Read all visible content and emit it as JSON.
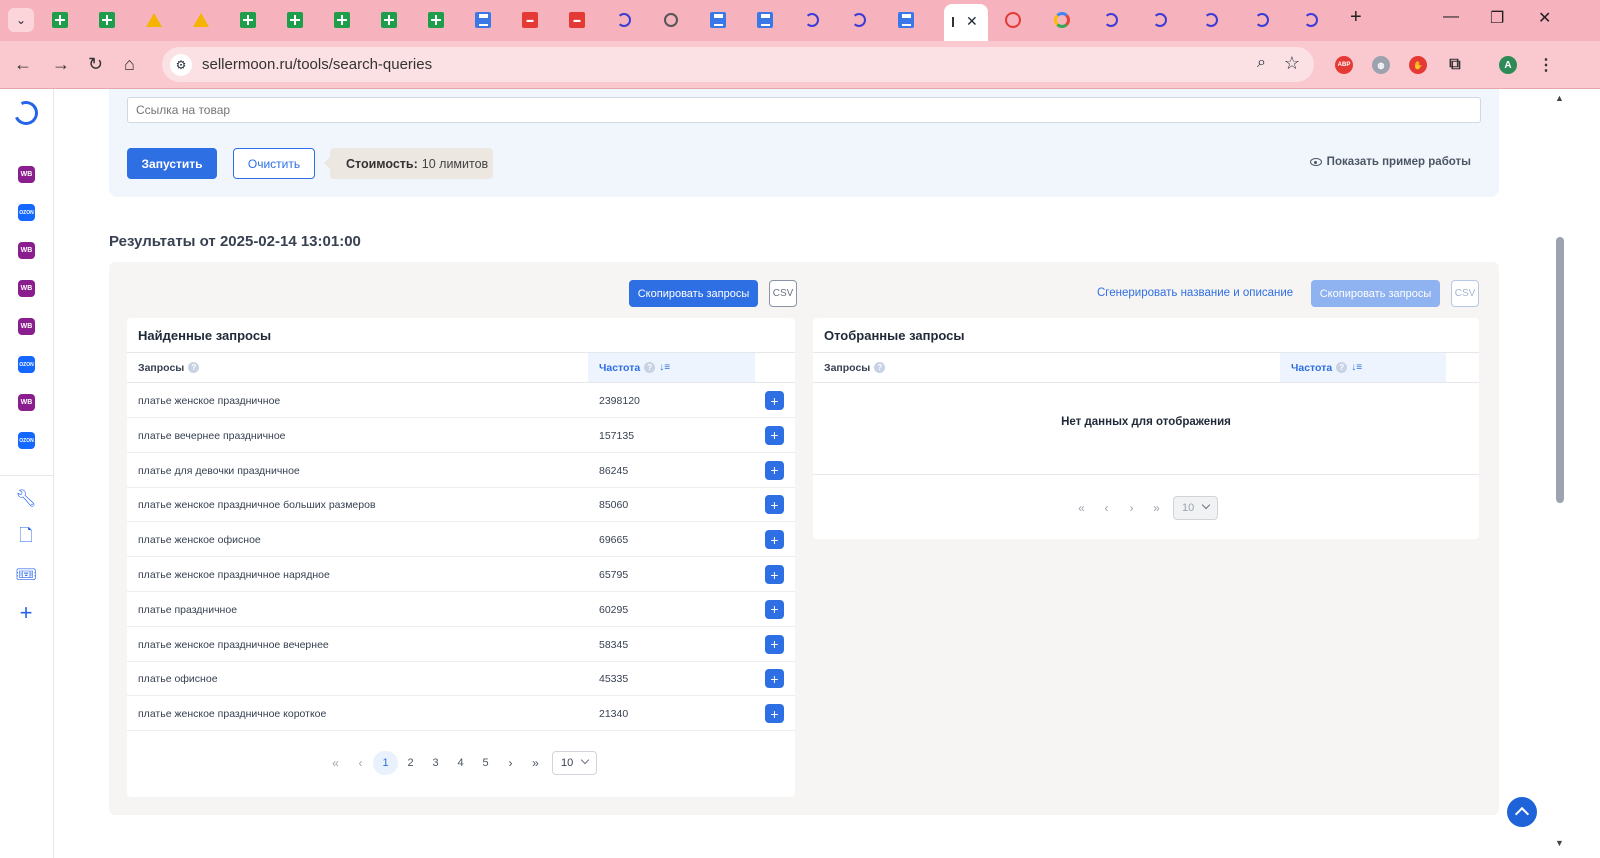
{
  "browser": {
    "url": "sellermoon.ru/tools/search-queries",
    "profile_initial": "A",
    "tabs": [
      {
        "icon": "sheets-icon"
      },
      {
        "icon": "sheets-icon"
      },
      {
        "icon": "drive-icon"
      },
      {
        "icon": "drive-icon"
      },
      {
        "icon": "sheets-icon"
      },
      {
        "icon": "sheets-icon"
      },
      {
        "icon": "sheets-icon"
      },
      {
        "icon": "sheets-icon"
      },
      {
        "icon": "sheets-icon"
      },
      {
        "icon": "docs-icon"
      },
      {
        "icon": "avito-icon"
      },
      {
        "icon": "avito-icon"
      },
      {
        "icon": "moon-icon"
      },
      {
        "icon": "openai-icon"
      },
      {
        "icon": "docs-icon"
      },
      {
        "icon": "docs-icon"
      },
      {
        "icon": "moon-icon"
      },
      {
        "icon": "moon-icon"
      },
      {
        "icon": "docs-icon"
      }
    ],
    "ext_labels": {
      "abp": "ABP"
    }
  },
  "sidebar": {
    "marketplaces": [
      "WB",
      "OZON",
      "WB",
      "WB",
      "WB",
      "OZON",
      "WB",
      "OZON"
    ]
  },
  "form": {
    "link_placeholder": "Ссылка на товар",
    "run_label": "Запустить",
    "clear_label": "Очистить",
    "cost_label": "Стоимость:",
    "cost_value": "10 лимитов",
    "example_label": "Показать пример работы"
  },
  "results": {
    "title": "Результаты от 2025-02-14 13:01:00",
    "copy_label": "Скопировать запросы",
    "csv_label": "CSV",
    "generate_label": "Сгенерировать название и описание",
    "found": {
      "title": "Найденные запросы",
      "col_query": "Запросы",
      "col_freq": "Частота",
      "rows": [
        {
          "query": "платье женское праздничное",
          "freq": "2398120"
        },
        {
          "query": "платье вечернее праздничное",
          "freq": "157135"
        },
        {
          "query": "платье для девочки праздничное",
          "freq": "86245"
        },
        {
          "query": "платье женское праздничное больших размеров",
          "freq": "85060"
        },
        {
          "query": "платье женское офисное",
          "freq": "69665"
        },
        {
          "query": "платье женское праздничное нарядное",
          "freq": "65795"
        },
        {
          "query": "платье праздничное",
          "freq": "60295"
        },
        {
          "query": "платье женское праздничное вечернее",
          "freq": "58345"
        },
        {
          "query": "платье офисное",
          "freq": "45335"
        },
        {
          "query": "платье женское праздничное короткое",
          "freq": "21340"
        }
      ],
      "pages": [
        "1",
        "2",
        "3",
        "4",
        "5"
      ],
      "page_size": "10"
    },
    "selected": {
      "title": "Отобранные запросы",
      "col_query": "Запросы",
      "col_freq": "Частота",
      "empty_text": "Нет данных для отображения",
      "page_size": "10"
    }
  }
}
